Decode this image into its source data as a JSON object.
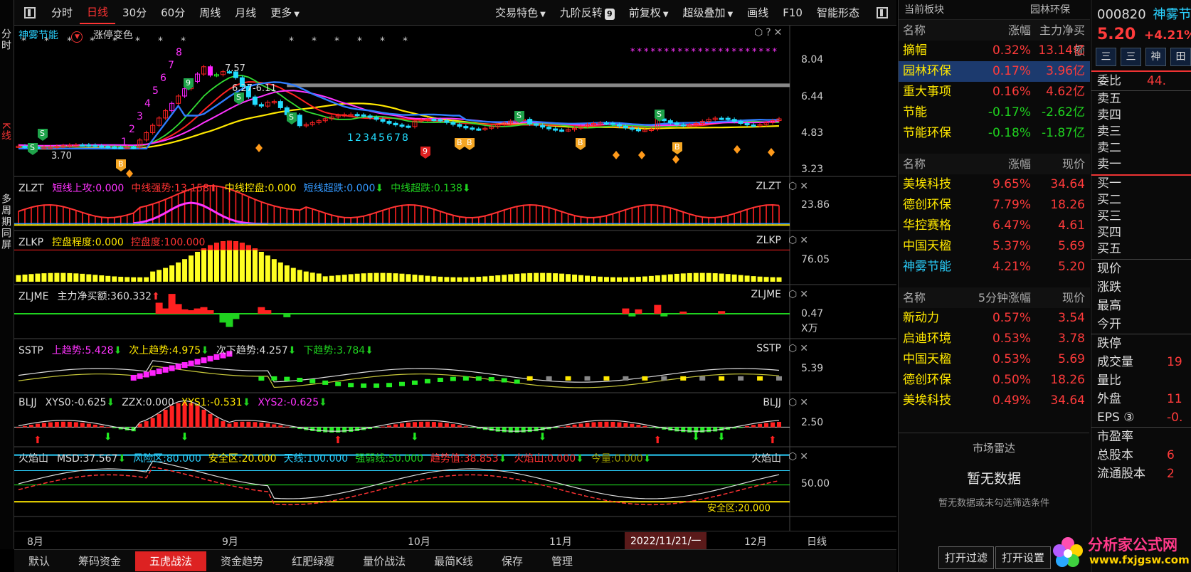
{
  "left_strip": {
    "fenshi": "分时",
    "kline": "K线",
    "duozhou": "多周期同屏"
  },
  "toolbar": {
    "items": [
      "分时",
      "日线",
      "30分",
      "60分",
      "周线",
      "月线",
      "更多"
    ],
    "right_items": [
      "交易特色",
      "九阶反转",
      "前复权",
      "超级叠加",
      "画线",
      "F10",
      "智能形态"
    ],
    "nine_badge": "9"
  },
  "main_panel": {
    "title": "神雾节能",
    "sub": "涨停变色",
    "price_labels": [
      "8.04",
      "6.44",
      "4.83",
      "3.23"
    ],
    "annotations": {
      "high": "7.57",
      "range": "6.27-6.11",
      "low": "3.70"
    },
    "count_up": [
      "1",
      "2",
      "3",
      "4",
      "5",
      "6",
      "7",
      "8"
    ],
    "count_down": [
      "1",
      "2",
      "3",
      "4",
      "5",
      "6",
      "7",
      "8"
    ]
  },
  "panels": [
    {
      "id": "ZLZT",
      "name": "ZLZT",
      "items": [
        {
          "t": "短线上攻:0.000",
          "c": "#ff33ff"
        },
        {
          "t": "中线强势:13.158",
          "c": "#ff3333",
          "arrow": "up"
        },
        {
          "t": "中线控盘:0.000",
          "c": "#ffe800"
        },
        {
          "t": "短线超跌:0.000",
          "c": "#3399ff",
          "arrow": "down"
        },
        {
          "t": "中线超跌:0.138",
          "c": "#1fd21f",
          "arrow": "down"
        }
      ],
      "axis": "23.86"
    },
    {
      "id": "ZLKP",
      "name": "ZLKP",
      "items": [
        {
          "t": "控盘程度:0.000",
          "c": "#ffe800"
        },
        {
          "t": "控盘度:100.000",
          "c": "#ff3333"
        }
      ],
      "axis": "76.05"
    },
    {
      "id": "ZLJME",
      "name": "ZLJME",
      "items": [
        {
          "t": "主力净买额:360.332",
          "c": "#ddd",
          "arrow": "up"
        }
      ],
      "axis": "0.47",
      "unit": "X万"
    },
    {
      "id": "SSTP",
      "name": "SSTP",
      "items": [
        {
          "t": "上趋势:5.428",
          "c": "#ff33ff",
          "arrow": "down"
        },
        {
          "t": "次上趋势:4.975",
          "c": "#ffe800",
          "arrow": "down"
        },
        {
          "t": "次下趋势:4.257",
          "c": "#ddd",
          "arrow": "down"
        },
        {
          "t": "下趋势:3.784",
          "c": "#1fd21f",
          "arrow": "down"
        }
      ],
      "axis": "5.39"
    },
    {
      "id": "BLJJ",
      "name": "BLJJ",
      "items": [
        {
          "t": "XYS0:-0.625",
          "c": "#ddd",
          "arrow": "down"
        },
        {
          "t": "ZZX:0.000",
          "c": "#ddd"
        },
        {
          "t": "XYS1:-0.531",
          "c": "#ffe800",
          "arrow": "down"
        },
        {
          "t": "XYS2:-0.625",
          "c": "#ff33ff",
          "arrow": "down"
        }
      ],
      "axis": "2.50"
    },
    {
      "id": "HYS",
      "name": "火焰山",
      "items": [
        {
          "t": "MSD:37.567",
          "c": "#ddd",
          "arrow": "down"
        },
        {
          "t": "风险区:80.000",
          "c": "#2ad1ff"
        },
        {
          "t": "安全区:20.000",
          "c": "#ffe800"
        },
        {
          "t": "天线:100.000",
          "c": "#2ad1ff"
        },
        {
          "t": "强弱线:50.000",
          "c": "#1fd21f"
        },
        {
          "t": "趋势值:38.853",
          "c": "#ff3333",
          "arrow": "down"
        },
        {
          "t": "火焰山:0.000",
          "c": "#ff3333",
          "arrow": "down"
        },
        {
          "t": "今量:0.000",
          "c": "#999900",
          "arrow": "down"
        }
      ],
      "axis": "50.00",
      "safe_tag": "安全区:20.000"
    }
  ],
  "timebar": {
    "months": [
      "8月",
      "9月",
      "10月",
      "11月",
      "12月"
    ],
    "cursor_date": "2022/11/21/一",
    "period": "日线"
  },
  "tabs": [
    "默认",
    "筹码资金",
    "五虎战法",
    "资金趋势",
    "红肥绿瘦",
    "量价战法",
    "最简K线",
    "保存",
    "管理"
  ],
  "sectors": {
    "head_left": "当前板块",
    "head_right": "园林环保",
    "table1": {
      "cols": [
        "名称",
        "涨幅",
        "主力净买额"
      ],
      "rows": [
        [
          "摘帽",
          "0.32%",
          "13.14亿"
        ],
        [
          "园林环保",
          "0.17%",
          "3.96亿"
        ],
        [
          "重大事项",
          "0.16%",
          "4.62亿"
        ],
        [
          "节能",
          "-0.17%",
          "-2.62亿"
        ],
        [
          "节能环保",
          "-0.18%",
          "-1.87亿"
        ]
      ]
    },
    "table2": {
      "cols": [
        "名称",
        "涨幅",
        "现价"
      ],
      "rows": [
        [
          "美埃科技",
          "9.65%",
          "34.64"
        ],
        [
          "德创环保",
          "7.79%",
          "18.26"
        ],
        [
          "华控赛格",
          "6.47%",
          "4.61"
        ],
        [
          "中国天楹",
          "5.37%",
          "5.69"
        ],
        [
          "神雾节能",
          "4.21%",
          "5.20"
        ]
      ]
    },
    "table3": {
      "cols": [
        "名称",
        "5分钟涨幅",
        "现价"
      ],
      "rows": [
        [
          "新动力",
          "0.57%",
          "3.54"
        ],
        [
          "启迪环境",
          "0.53%",
          "3.78"
        ],
        [
          "中国天楹",
          "0.53%",
          "5.69"
        ],
        [
          "德创环保",
          "0.50%",
          "18.26"
        ],
        [
          "美埃科技",
          "0.49%",
          "34.64"
        ]
      ]
    },
    "radar_title": "市场雷达",
    "radar_empty": "暂无数据",
    "radar_hint": "暂无数据或未勾选筛选条件",
    "btn_filter": "打开过滤",
    "btn_settings": "打开设置"
  },
  "quote": {
    "code": "000820",
    "name": "神雾节",
    "price": "5.20",
    "change": "+4.21%",
    "btns": [
      "三",
      "三",
      "神",
      "田"
    ],
    "weibi": "委比",
    "weibi_val": "44.",
    "sells": [
      "卖五",
      "卖四",
      "卖三",
      "卖二",
      "卖一"
    ],
    "buys": [
      "买一",
      "买二",
      "买三",
      "买四",
      "买五"
    ],
    "stats": [
      [
        "现价",
        ""
      ],
      [
        "涨跌",
        ""
      ],
      [
        "最高",
        ""
      ],
      [
        "今开",
        ""
      ],
      [
        "跌停",
        ""
      ],
      [
        "成交量",
        "19"
      ],
      [
        "量比",
        ""
      ],
      [
        "外盘",
        "11"
      ],
      [
        "EPS ③",
        "-0."
      ],
      [
        "市盈率",
        ""
      ],
      [
        "总股本",
        "6"
      ],
      [
        "流通股本",
        "2"
      ]
    ]
  },
  "watermark": {
    "title": "分析家公式网",
    "url": "www.fxjgsw.com"
  }
}
